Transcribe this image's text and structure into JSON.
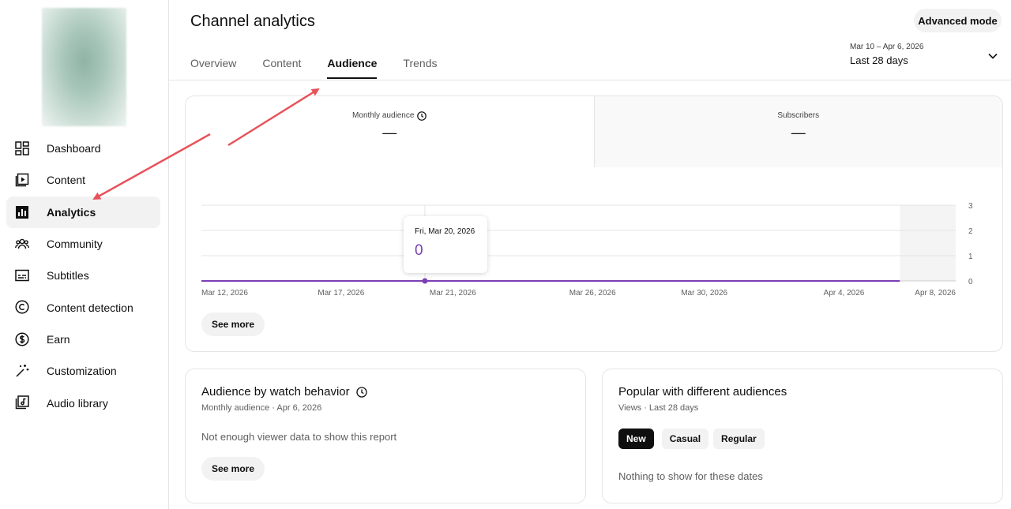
{
  "sidebar": {
    "items": [
      {
        "label": "Dashboard",
        "icon": "dashboard-icon",
        "active": false
      },
      {
        "label": "Content",
        "icon": "content-icon",
        "active": false
      },
      {
        "label": "Analytics",
        "icon": "analytics-icon",
        "active": true
      },
      {
        "label": "Community",
        "icon": "community-icon",
        "active": false
      },
      {
        "label": "Subtitles",
        "icon": "subtitles-icon",
        "active": false
      },
      {
        "label": "Content detection",
        "icon": "copyright-icon",
        "active": false
      },
      {
        "label": "Earn",
        "icon": "dollar-icon",
        "active": false
      },
      {
        "label": "Customization",
        "icon": "magic-wand-icon",
        "active": false
      },
      {
        "label": "Audio library",
        "icon": "audio-library-icon",
        "active": false
      }
    ]
  },
  "header": {
    "title": "Channel analytics",
    "advanced_mode": "Advanced mode",
    "tabs": [
      {
        "label": "Overview",
        "active": false
      },
      {
        "label": "Content",
        "active": false
      },
      {
        "label": "Audience",
        "active": true
      },
      {
        "label": "Trends",
        "active": false
      }
    ],
    "date_range": {
      "dates": "Mar 10 – Apr 6, 2026",
      "period": "Last 28 days"
    }
  },
  "overview_card": {
    "metrics": [
      {
        "label": "Monthly audience",
        "value": "—"
      },
      {
        "label": "Subscribers",
        "value": "—"
      }
    ],
    "see_more": "See more",
    "tooltip": {
      "date": "Fri, Mar 20, 2026",
      "value": "0"
    }
  },
  "chart_data": {
    "type": "line",
    "x_tick_labels": [
      "Mar 12, 2026",
      "Mar 17, 2026",
      "Mar 21, 2026",
      "Mar 26, 2026",
      "Mar 30, 2026",
      "Apr 4, 2026",
      "Apr 8, 2026"
    ],
    "y_tick_labels": [
      "3",
      "2",
      "1",
      "0"
    ],
    "ylim": [
      0,
      3
    ],
    "x": [
      "Mar 10, 2026",
      "Apr 6, 2026"
    ],
    "series": [
      {
        "values": [
          0,
          0
        ]
      }
    ],
    "highlight": {
      "x": "Mar 20, 2026",
      "y": 0
    },
    "shaded_from": "Apr 6, 2026",
    "grid": true,
    "line_color": "#7b3fb5"
  },
  "watch_behavior": {
    "title": "Audience by watch behavior",
    "subtitle": "Monthly audience · Apr 6, 2026",
    "empty": "Not enough viewer data to show this report",
    "see_more": "See more"
  },
  "popular": {
    "title": "Popular with different audiences",
    "subtitle": "Views · Last 28 days",
    "chips": [
      {
        "label": "New",
        "active": true
      },
      {
        "label": "Casual",
        "active": false
      },
      {
        "label": "Regular",
        "active": false
      }
    ],
    "empty": "Nothing to show for these dates"
  },
  "colors": {
    "accent": "#7b3fb5",
    "arrow": "#e8525a"
  }
}
